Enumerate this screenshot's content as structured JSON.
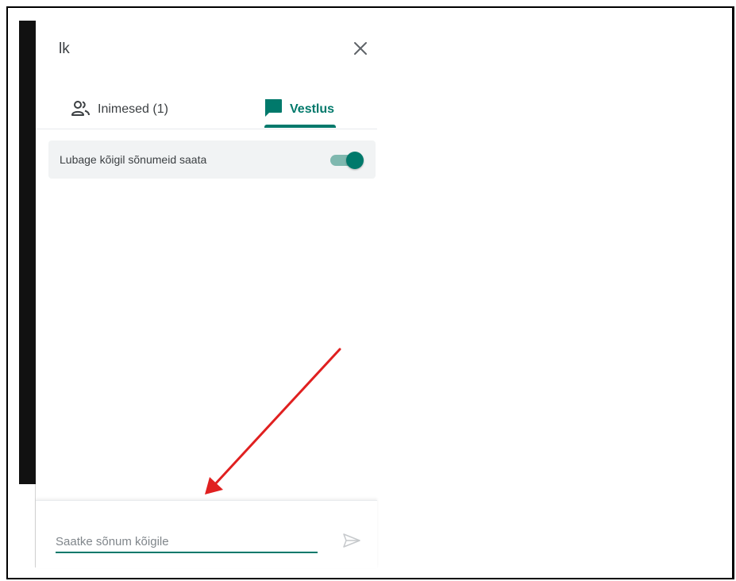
{
  "panel": {
    "title": "lk",
    "tabs": [
      {
        "label": "Inimesed (1)",
        "icon": "people-icon",
        "active": false
      },
      {
        "label": "Vestlus",
        "icon": "chat-bubble-icon",
        "active": true
      }
    ],
    "setting": {
      "label": "Lubage kõigil sõnumeid saata",
      "enabled": true
    },
    "composer": {
      "placeholder": "Saatke sõnum kõigile",
      "send_icon": "send-icon"
    }
  },
  "colors": {
    "accent": "#00796b",
    "toggle_track": "#7fb8af",
    "annotation_arrow": "#e02020"
  },
  "annotation": {
    "type": "arrow",
    "points_to": "message-input"
  }
}
